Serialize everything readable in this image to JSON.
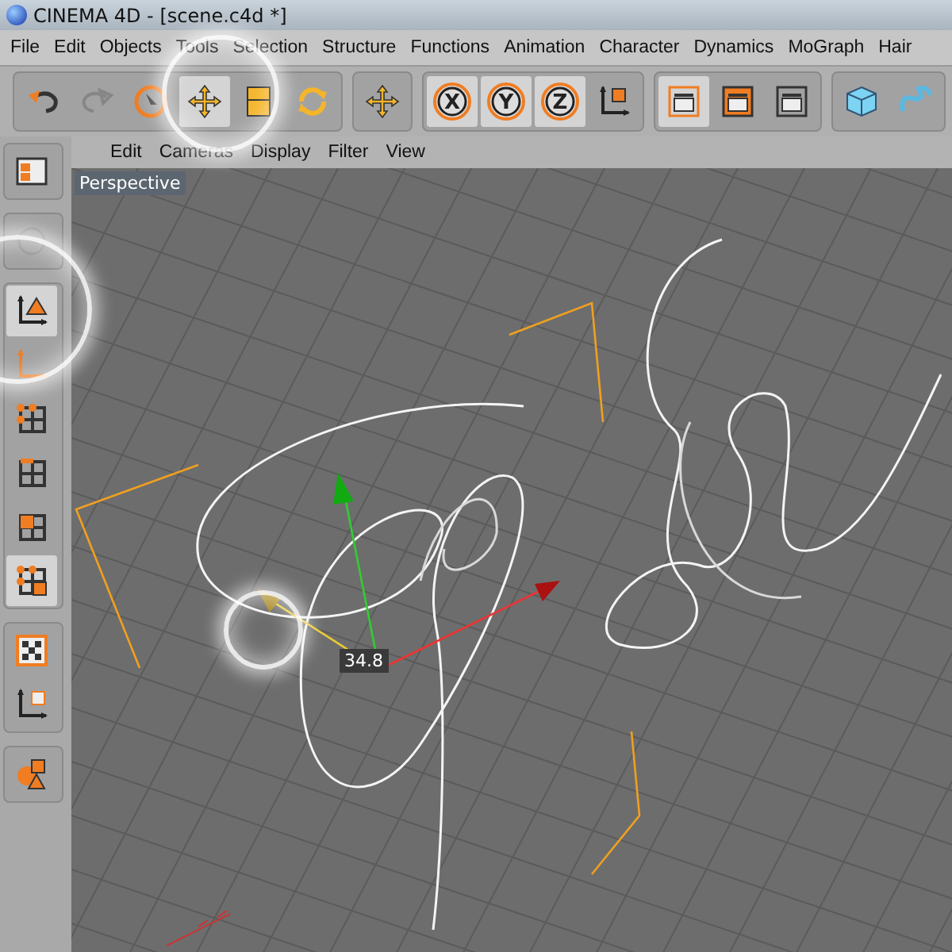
{
  "window": {
    "title": "CINEMA 4D - [scene.c4d *]"
  },
  "menu": [
    "File",
    "Edit",
    "Objects",
    "Tools",
    "Selection",
    "Structure",
    "Functions",
    "Animation",
    "Character",
    "Dynamics",
    "MoGraph",
    "Hair"
  ],
  "toolbar": [
    {
      "tools": [
        {
          "kind": "undo",
          "selected": false,
          "disabled": false
        },
        {
          "kind": "redo",
          "selected": false,
          "disabled": true
        },
        {
          "kind": "live-select",
          "selected": false,
          "disabled": false
        },
        {
          "kind": "move",
          "selected": true,
          "disabled": false
        },
        {
          "kind": "scale",
          "selected": false,
          "disabled": false
        },
        {
          "kind": "rotate",
          "selected": false,
          "disabled": false
        }
      ]
    },
    {
      "tools": [
        {
          "kind": "move",
          "selected": false,
          "disabled": false
        }
      ]
    },
    {
      "tools": [
        {
          "kind": "axis-lock",
          "label": "X",
          "selected": true,
          "disabled": false
        },
        {
          "kind": "axis-lock",
          "label": "Y",
          "selected": true,
          "disabled": false
        },
        {
          "kind": "axis-lock",
          "label": "Z",
          "selected": true,
          "disabled": false
        },
        {
          "kind": "coordinates",
          "selected": false,
          "disabled": false
        }
      ]
    },
    {
      "tools": [
        {
          "kind": "render-view",
          "selected": true,
          "disabled": false
        },
        {
          "kind": "render-picture",
          "selected": false,
          "disabled": false
        },
        {
          "kind": "render-settings",
          "selected": false,
          "disabled": false
        }
      ]
    },
    {
      "tools": [
        {
          "kind": "cube",
          "selected": false,
          "disabled": false
        },
        {
          "kind": "spline",
          "selected": false,
          "disabled": false
        }
      ]
    }
  ],
  "sidebar": [
    {
      "tools": [
        {
          "kind": "layout",
          "selected": false,
          "disabled": false
        }
      ]
    },
    {
      "tools": [
        {
          "kind": "navigate",
          "selected": false,
          "disabled": true
        }
      ]
    },
    {
      "tools": [
        {
          "kind": "object-axis",
          "selected": true,
          "disabled": false
        },
        {
          "kind": "model-axis",
          "selected": false,
          "disabled": false
        },
        {
          "kind": "points",
          "selected": false,
          "disabled": false
        },
        {
          "kind": "edges",
          "selected": false,
          "disabled": false
        },
        {
          "kind": "polygons",
          "selected": false,
          "disabled": false
        },
        {
          "kind": "multi-select",
          "selected": true,
          "disabled": false
        }
      ]
    },
    {
      "tools": [
        {
          "kind": "texture",
          "selected": false,
          "disabled": false
        },
        {
          "kind": "texture-axis",
          "selected": false,
          "disabled": false
        }
      ]
    },
    {
      "tools": [
        {
          "kind": "primitives",
          "selected": false,
          "disabled": false
        }
      ]
    }
  ],
  "viewport": {
    "menu": [
      "Edit",
      "Cameras",
      "Display",
      "Filter",
      "View"
    ],
    "camera": "Perspective",
    "readout": "34.8"
  }
}
